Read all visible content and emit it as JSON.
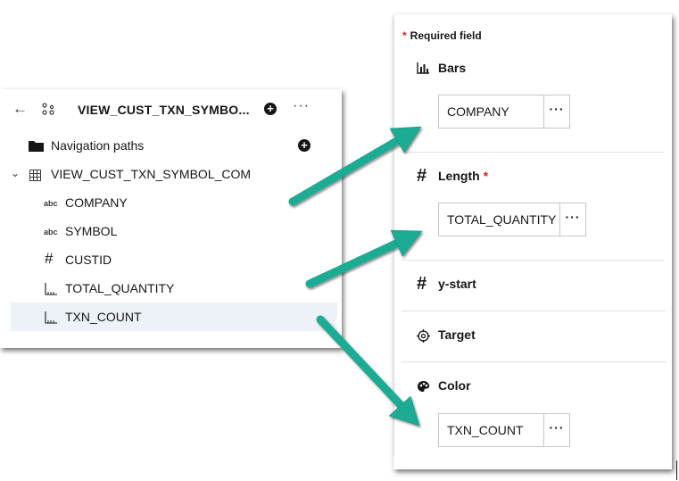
{
  "left": {
    "title": "VIEW_CUST_TXN_SYMBO...",
    "navigation_paths": "Navigation paths",
    "table_name": "VIEW_CUST_TXN_SYMBOL_COM",
    "columns": [
      {
        "name": "COMPANY",
        "type_label": "abc"
      },
      {
        "name": "SYMBOL",
        "type_label": "abc"
      },
      {
        "name": "CUSTID",
        "type_label": "#"
      },
      {
        "name": "TOTAL_QUANTITY",
        "type_label": "measure"
      },
      {
        "name": "TXN_COUNT",
        "type_label": "measure"
      }
    ]
  },
  "right": {
    "required_field": "Required field",
    "required_star": "*",
    "bars": {
      "label": "Bars",
      "value": "COMPANY"
    },
    "length": {
      "label": "Length",
      "value": "TOTAL_QUANTITY"
    },
    "ystart": {
      "label": "y-start"
    },
    "target": {
      "label": "Target"
    },
    "color": {
      "label": "Color",
      "value": "TXN_COUNT"
    },
    "more_label": "···"
  },
  "icons": {
    "back": "arrow-left-icon",
    "hierarchy": "hierarchy-icon",
    "add": "add-filled-icon",
    "overflow": "overflow-menu-icon",
    "folder": "folder-icon",
    "table": "table-icon",
    "chevron": "chevron-down-icon",
    "bars": "bar-chart-icon",
    "hash": "hashtag-icon",
    "target": "crosshair-icon",
    "color": "color-palette-icon"
  },
  "colors": {
    "arrow": "#1aab93",
    "selected_row": "#edf1f8",
    "required": "#da1e28"
  }
}
